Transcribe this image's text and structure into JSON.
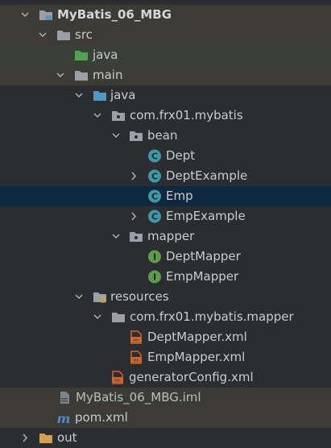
{
  "project": {
    "name": "MyBatis_06_MBG"
  },
  "tree": {
    "src": "src",
    "java_top": "java",
    "main": "main",
    "java": "java",
    "pkg": "com.frx01.mybatis",
    "bean": "bean",
    "dept": "Dept",
    "dept_example": "DeptExample",
    "emp": "Emp",
    "emp_example": "EmpExample",
    "mapper": "mapper",
    "dept_mapper": "DeptMapper",
    "emp_mapper": "EmpMapper",
    "resources": "resources",
    "res_pkg": "com.frx01.mybatis.mapper",
    "dept_mapper_xml": "DeptMapper.xml",
    "emp_mapper_xml": "EmpMapper.xml",
    "generator_config": "generatorConfig.xml",
    "iml": "MyBatis_06_MBG.iml",
    "pom": "pom.xml",
    "out": "out"
  },
  "colors": {
    "background": "#2b2d30",
    "selected_row": "#0f2a40",
    "brown_row": "#3c3b35",
    "green_row": "#374138",
    "class_badge": "#3f98a8",
    "interface_badge": "#5e9c4b",
    "xml_icon": "#d0662e",
    "folder": "#9aa0a6",
    "source_folder": "#4f97c7",
    "test_folder": "#51a351",
    "maven": "#4a8fd1"
  }
}
